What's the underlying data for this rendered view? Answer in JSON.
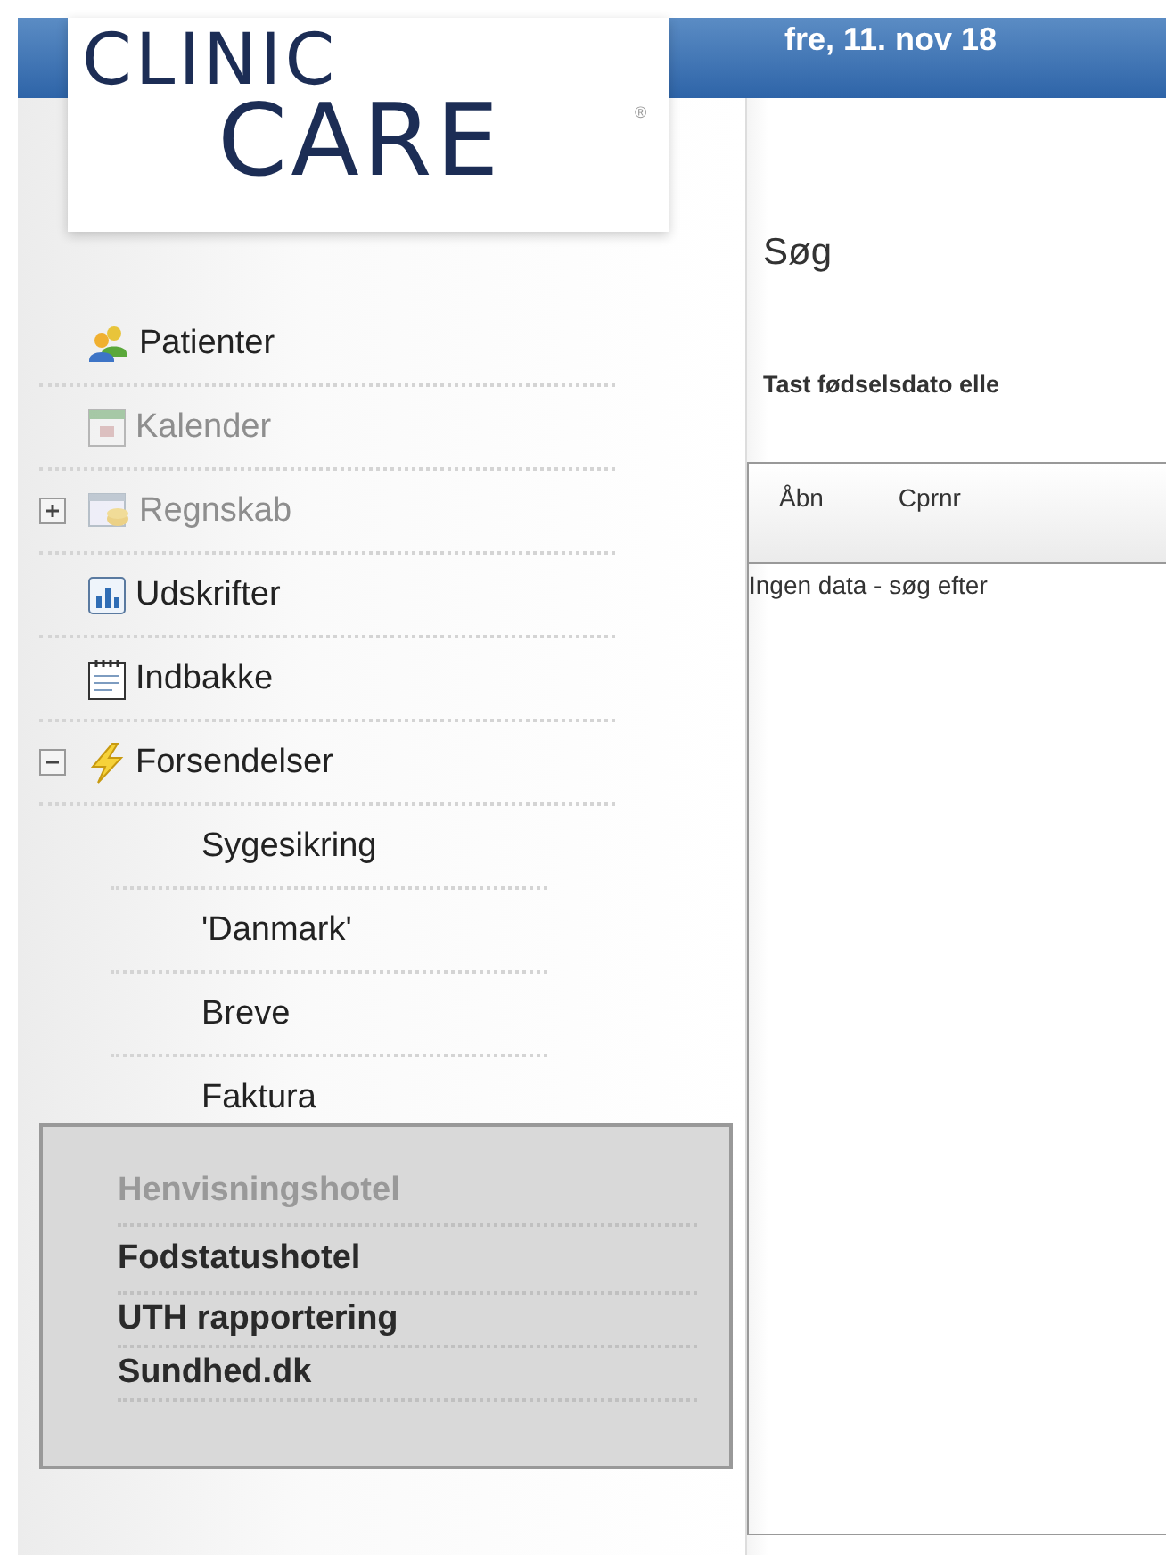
{
  "header": {
    "date": "fre, 11. nov 18"
  },
  "logo": {
    "line1": "CLINIC",
    "line2": "CARE",
    "mark": "®"
  },
  "sidebar": {
    "items": [
      {
        "label": "Patienter",
        "kind": "people",
        "disabled": false
      },
      {
        "label": "Kalender",
        "kind": "calendar",
        "disabled": true
      },
      {
        "label": "Regnskab",
        "kind": "ledger",
        "disabled": true,
        "expanded": false
      },
      {
        "label": "Udskrifter",
        "kind": "report",
        "disabled": false
      },
      {
        "label": "Indbakke",
        "kind": "notepad",
        "disabled": false
      },
      {
        "label": "Forsendelser",
        "kind": "lightning",
        "disabled": false,
        "expanded": true,
        "children": [
          {
            "label": "Sygesikring"
          },
          {
            "label": "'Danmark'"
          },
          {
            "label": "Breve"
          },
          {
            "label": "Faktura"
          }
        ]
      }
    ]
  },
  "popup_menu": {
    "items": [
      {
        "label": "Henvisningshotel",
        "disabled": true
      },
      {
        "label": "Fodstatushotel",
        "disabled": false
      },
      {
        "label": "UTH rapportering",
        "disabled": false
      },
      {
        "label": "Sundhed.dk",
        "disabled": false
      }
    ]
  },
  "main": {
    "title": "Søg",
    "instruction": "Tast fødselsdato elle",
    "table": {
      "columns": [
        "Åbn",
        "Cprnr"
      ],
      "empty_message": "Ingen data - søg efter"
    }
  }
}
